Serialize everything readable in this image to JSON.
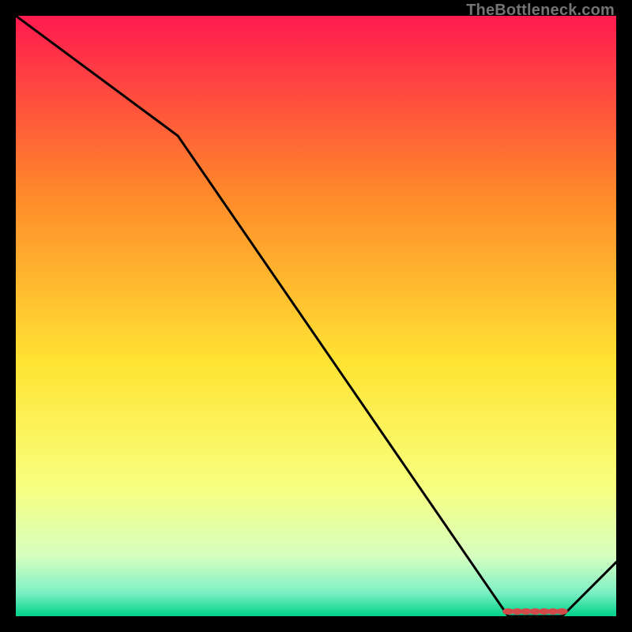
{
  "attribution": "TheBottleneck.com",
  "chart_data": {
    "type": "line",
    "title": "",
    "xlabel": "",
    "ylabel": "",
    "xlim": [
      0,
      100
    ],
    "ylim": [
      0,
      100
    ],
    "x": [
      0,
      27,
      82,
      91,
      100
    ],
    "values": [
      100,
      80,
      0,
      0,
      9
    ],
    "minimum_zone": {
      "x_start": 82,
      "x_end": 91,
      "value": 0
    },
    "gradient_colors": {
      "top": "#ff1a4f",
      "mid_upper": "#ff8a2a",
      "mid": "#ffe433",
      "mid_lower": "#f8ff7d",
      "low1": "#d7ffc0",
      "low2": "#7ff0c5",
      "bottom": "#00d28a"
    }
  }
}
